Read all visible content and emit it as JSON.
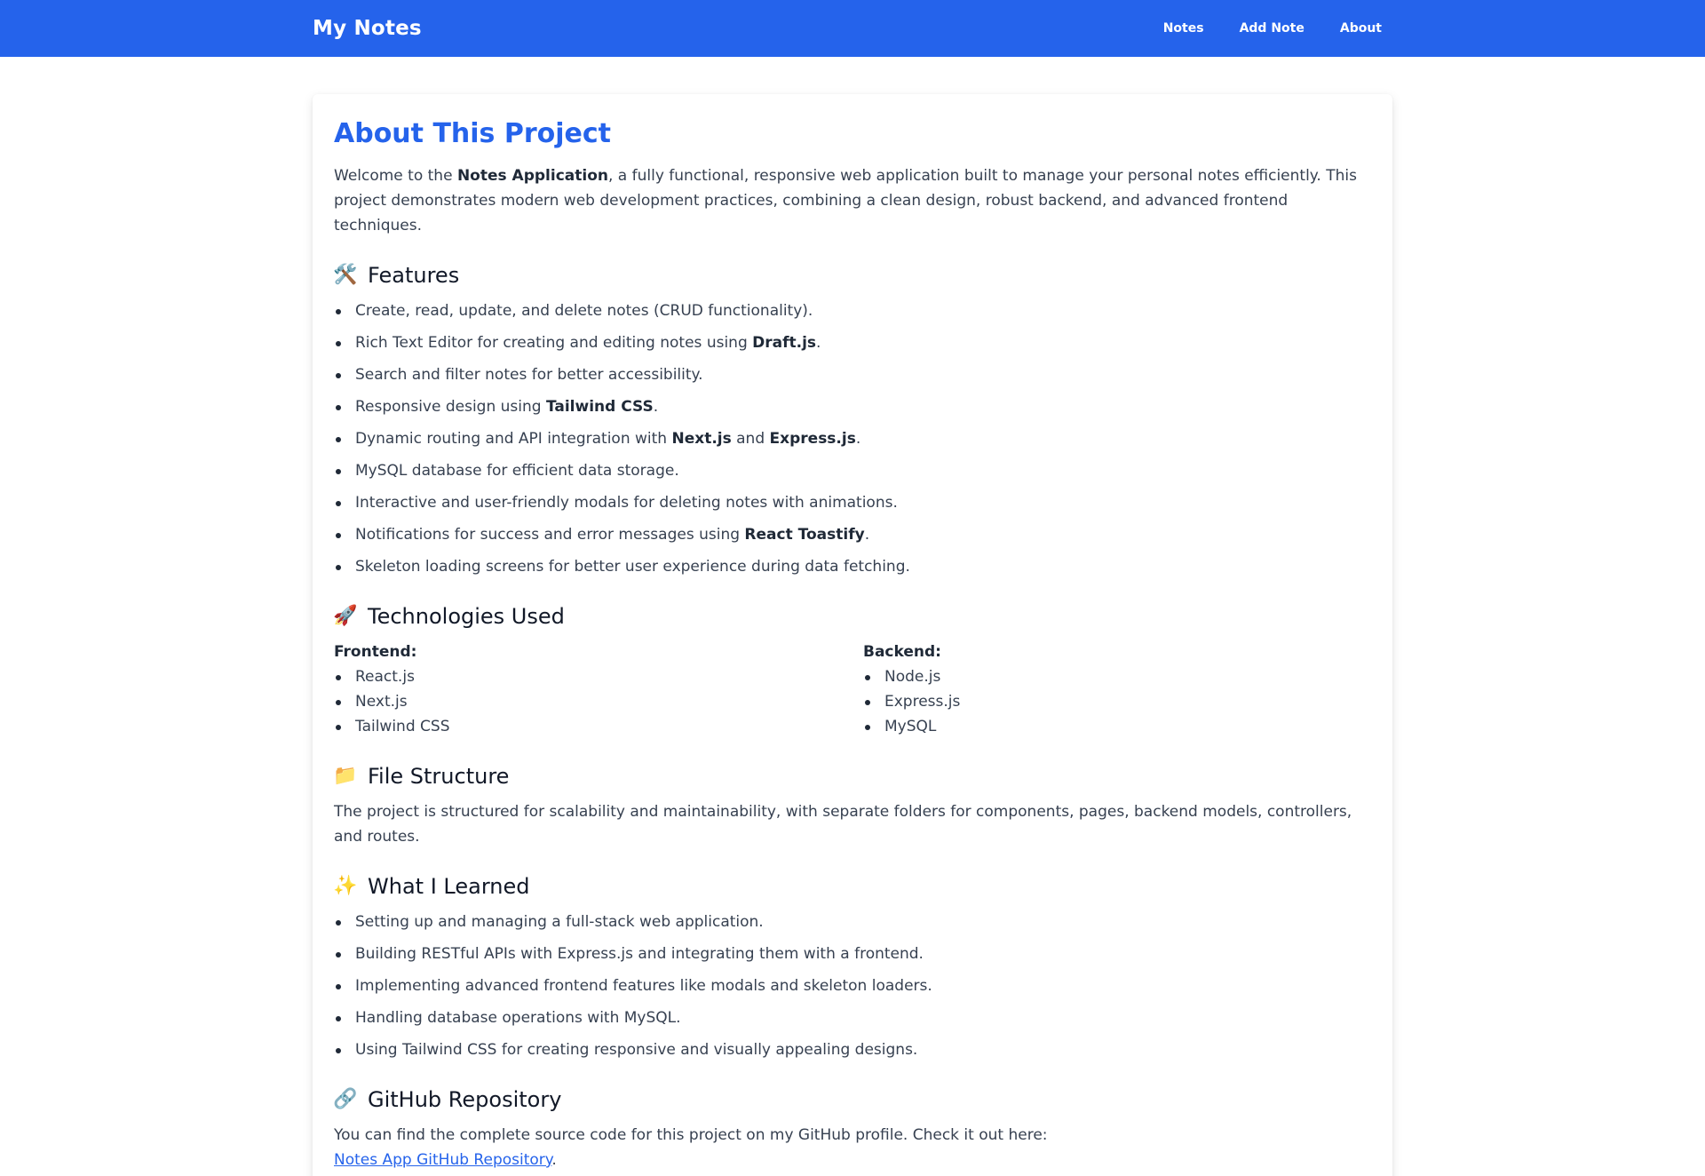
{
  "nav": {
    "brand": "My Notes",
    "links": [
      "Notes",
      "Add Note",
      "About"
    ]
  },
  "about": {
    "title": "About This Project",
    "intro": {
      "before": "Welcome to the ",
      "bold": "Notes Application",
      "after": ", a fully functional, responsive web application built to manage your personal notes efficiently. This project demonstrates modern web development practices, combining a clean design, robust backend, and advanced frontend techniques."
    },
    "features": {
      "icon": "hammer-wrench-icon",
      "emoji": "🛠️",
      "heading": "Features",
      "items": [
        {
          "parts": [
            {
              "t": "Create, read, update, and delete notes (CRUD functionality)."
            }
          ]
        },
        {
          "parts": [
            {
              "t": "Rich Text Editor for creating and editing notes using "
            },
            {
              "t": "Draft.js",
              "b": true
            },
            {
              "t": "."
            }
          ]
        },
        {
          "parts": [
            {
              "t": "Search and filter notes for better accessibility."
            }
          ]
        },
        {
          "parts": [
            {
              "t": "Responsive design using "
            },
            {
              "t": "Tailwind CSS",
              "b": true
            },
            {
              "t": "."
            }
          ]
        },
        {
          "parts": [
            {
              "t": "Dynamic routing and API integration with "
            },
            {
              "t": "Next.js",
              "b": true
            },
            {
              "t": " and "
            },
            {
              "t": "Express.js",
              "b": true
            },
            {
              "t": "."
            }
          ]
        },
        {
          "parts": [
            {
              "t": "MySQL database for efficient data storage."
            }
          ]
        },
        {
          "parts": [
            {
              "t": "Interactive and user-friendly modals for deleting notes with animations."
            }
          ]
        },
        {
          "parts": [
            {
              "t": "Notifications for success and error messages using "
            },
            {
              "t": "React Toastify",
              "b": true
            },
            {
              "t": "."
            }
          ]
        },
        {
          "parts": [
            {
              "t": "Skeleton loading screens for better user experience during data fetching."
            }
          ]
        }
      ]
    },
    "technologies": {
      "icon": "rocket-icon",
      "emoji": "🚀",
      "heading": "Technologies Used",
      "frontend": {
        "label": "Frontend:",
        "items": [
          "React.js",
          "Next.js",
          "Tailwind CSS"
        ]
      },
      "backend": {
        "label": "Backend:",
        "items": [
          "Node.js",
          "Express.js",
          "MySQL"
        ]
      }
    },
    "file_structure": {
      "icon": "folder-icon",
      "emoji": "📁",
      "heading": "File Structure",
      "text": "The project is structured for scalability and maintainability, with separate folders for components, pages, backend models, controllers, and routes."
    },
    "learned": {
      "icon": "sparkles-icon",
      "emoji": "✨",
      "heading": "What I Learned",
      "items": [
        "Setting up and managing a full-stack web application.",
        "Building RESTful APIs with Express.js and integrating them with a frontend.",
        "Implementing advanced frontend features like modals and skeleton loaders.",
        "Handling database operations with MySQL.",
        "Using Tailwind CSS for creating responsive and visually appealing designs."
      ]
    },
    "github": {
      "icon": "link-icon",
      "emoji": "🔗",
      "heading": "GitHub Repository",
      "text": "You can find the complete source code for this project on my GitHub profile. Check it out here:",
      "link_text": "Notes App GitHub Repository",
      "after_link": "."
    }
  },
  "colors": {
    "primary": "#2563eb",
    "text": "#374151",
    "heading": "#111827"
  }
}
